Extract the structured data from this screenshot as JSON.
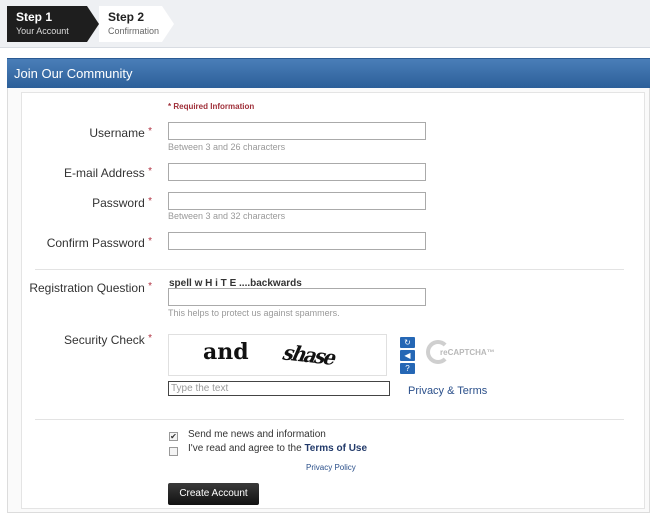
{
  "steps": [
    {
      "number": "Step 1",
      "label": "Your Account"
    },
    {
      "number": "Step 2",
      "label": "Confirmation"
    }
  ],
  "header": {
    "title": "Join Our Community"
  },
  "form": {
    "required_info": "* Required Information",
    "star": "*",
    "username": {
      "label": "Username",
      "value": "",
      "hint": "Between 3 and 26 characters"
    },
    "email": {
      "label": "E-mail Address",
      "value": ""
    },
    "password": {
      "label": "Password",
      "value": "",
      "hint": "Between 3 and 32 characters"
    },
    "confirm_password": {
      "label": "Confirm Password",
      "value": ""
    },
    "registration_question": {
      "label": "Registration Question",
      "question": "spell w H i T E ....backwards",
      "value": "",
      "hint": "This helps to protect us against spammers."
    },
    "security_check": {
      "label": "Security Check",
      "captcha_word1": "and",
      "captcha_word2": "shase",
      "placeholder": "Type the text",
      "privacy_terms": "Privacy & Terms",
      "refresh_icon": "refresh-icon",
      "audio_icon": "audio-icon",
      "help_icon": "help-icon",
      "logo_text": "reCAPTCHA™"
    },
    "newsletter": {
      "label": "Send me news and information",
      "checked": true
    },
    "terms": {
      "prefix": "I've read and agree to the ",
      "link": "Terms of Use",
      "checked": false
    },
    "privacy_policy": "Privacy Policy",
    "submit": "Create Account"
  },
  "colors": {
    "header": "#2c5f99",
    "required": "#a0303a",
    "link": "#2a4f8a"
  }
}
